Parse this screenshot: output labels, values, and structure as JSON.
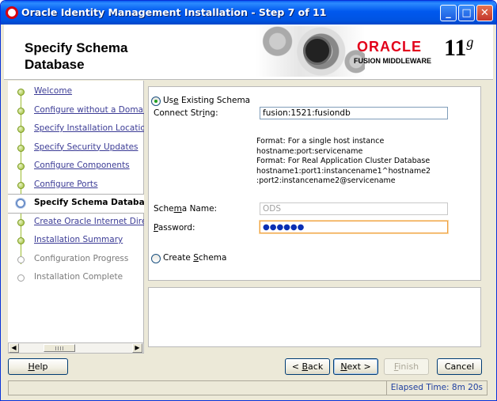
{
  "window": {
    "title": "Oracle Identity Management Installation - Step 7 of 11"
  },
  "header": {
    "page_title": "Specify Schema Database",
    "brand": "ORACLE",
    "product": "FUSION MIDDLEWARE",
    "version": "11",
    "version_suffix": "g"
  },
  "nav": {
    "items": [
      {
        "label": "Welcome",
        "state": "done"
      },
      {
        "label": "Configure without a Domain",
        "state": "done"
      },
      {
        "label": "Specify Installation Location",
        "state": "done"
      },
      {
        "label": "Specify Security Updates",
        "state": "done"
      },
      {
        "label": "Configure Components",
        "state": "done"
      },
      {
        "label": "Configure Ports",
        "state": "done"
      },
      {
        "label": "Specify Schema Database",
        "state": "current"
      },
      {
        "label": "Create Oracle Internet Directory",
        "state": "done"
      },
      {
        "label": "Installation Summary",
        "state": "done"
      },
      {
        "label": "Configuration Progress",
        "state": "future"
      },
      {
        "label": "Installation Complete",
        "state": "future"
      }
    ]
  },
  "form": {
    "use_existing_label_pre": "Us",
    "use_existing_label_key": "e",
    "use_existing_label_post": " Existing Schema",
    "connect_label_pre": "Connect Str",
    "connect_label_key": "i",
    "connect_label_post": "ng:",
    "connect_value": "fusion:1521:fusiondb",
    "help_lines": [
      "Format: For a single host instance",
      "hostname:port:servicename",
      "Format: For Real Application Cluster Database",
      "hostname1:port1:instancename1^hostname2",
      ":port2:instancename2@servicename"
    ],
    "schema_label_pre": "Sche",
    "schema_label_key": "m",
    "schema_label_post": "a Name:",
    "schema_value": "ODS",
    "password_label_key": "P",
    "password_label_post": "assword:",
    "password_value": "●●●●●●",
    "create_label_pre": "Create ",
    "create_label_key": "S",
    "create_label_post": "chema"
  },
  "buttons": {
    "help_key": "H",
    "help_post": "elp",
    "back_pre": "< ",
    "back_key": "B",
    "back_post": "ack",
    "next_key": "N",
    "next_post": "ext >",
    "finish_key": "F",
    "finish_post": "inish",
    "cancel": "Cancel"
  },
  "status": {
    "elapsed": "Elapsed Time: 8m 20s"
  }
}
